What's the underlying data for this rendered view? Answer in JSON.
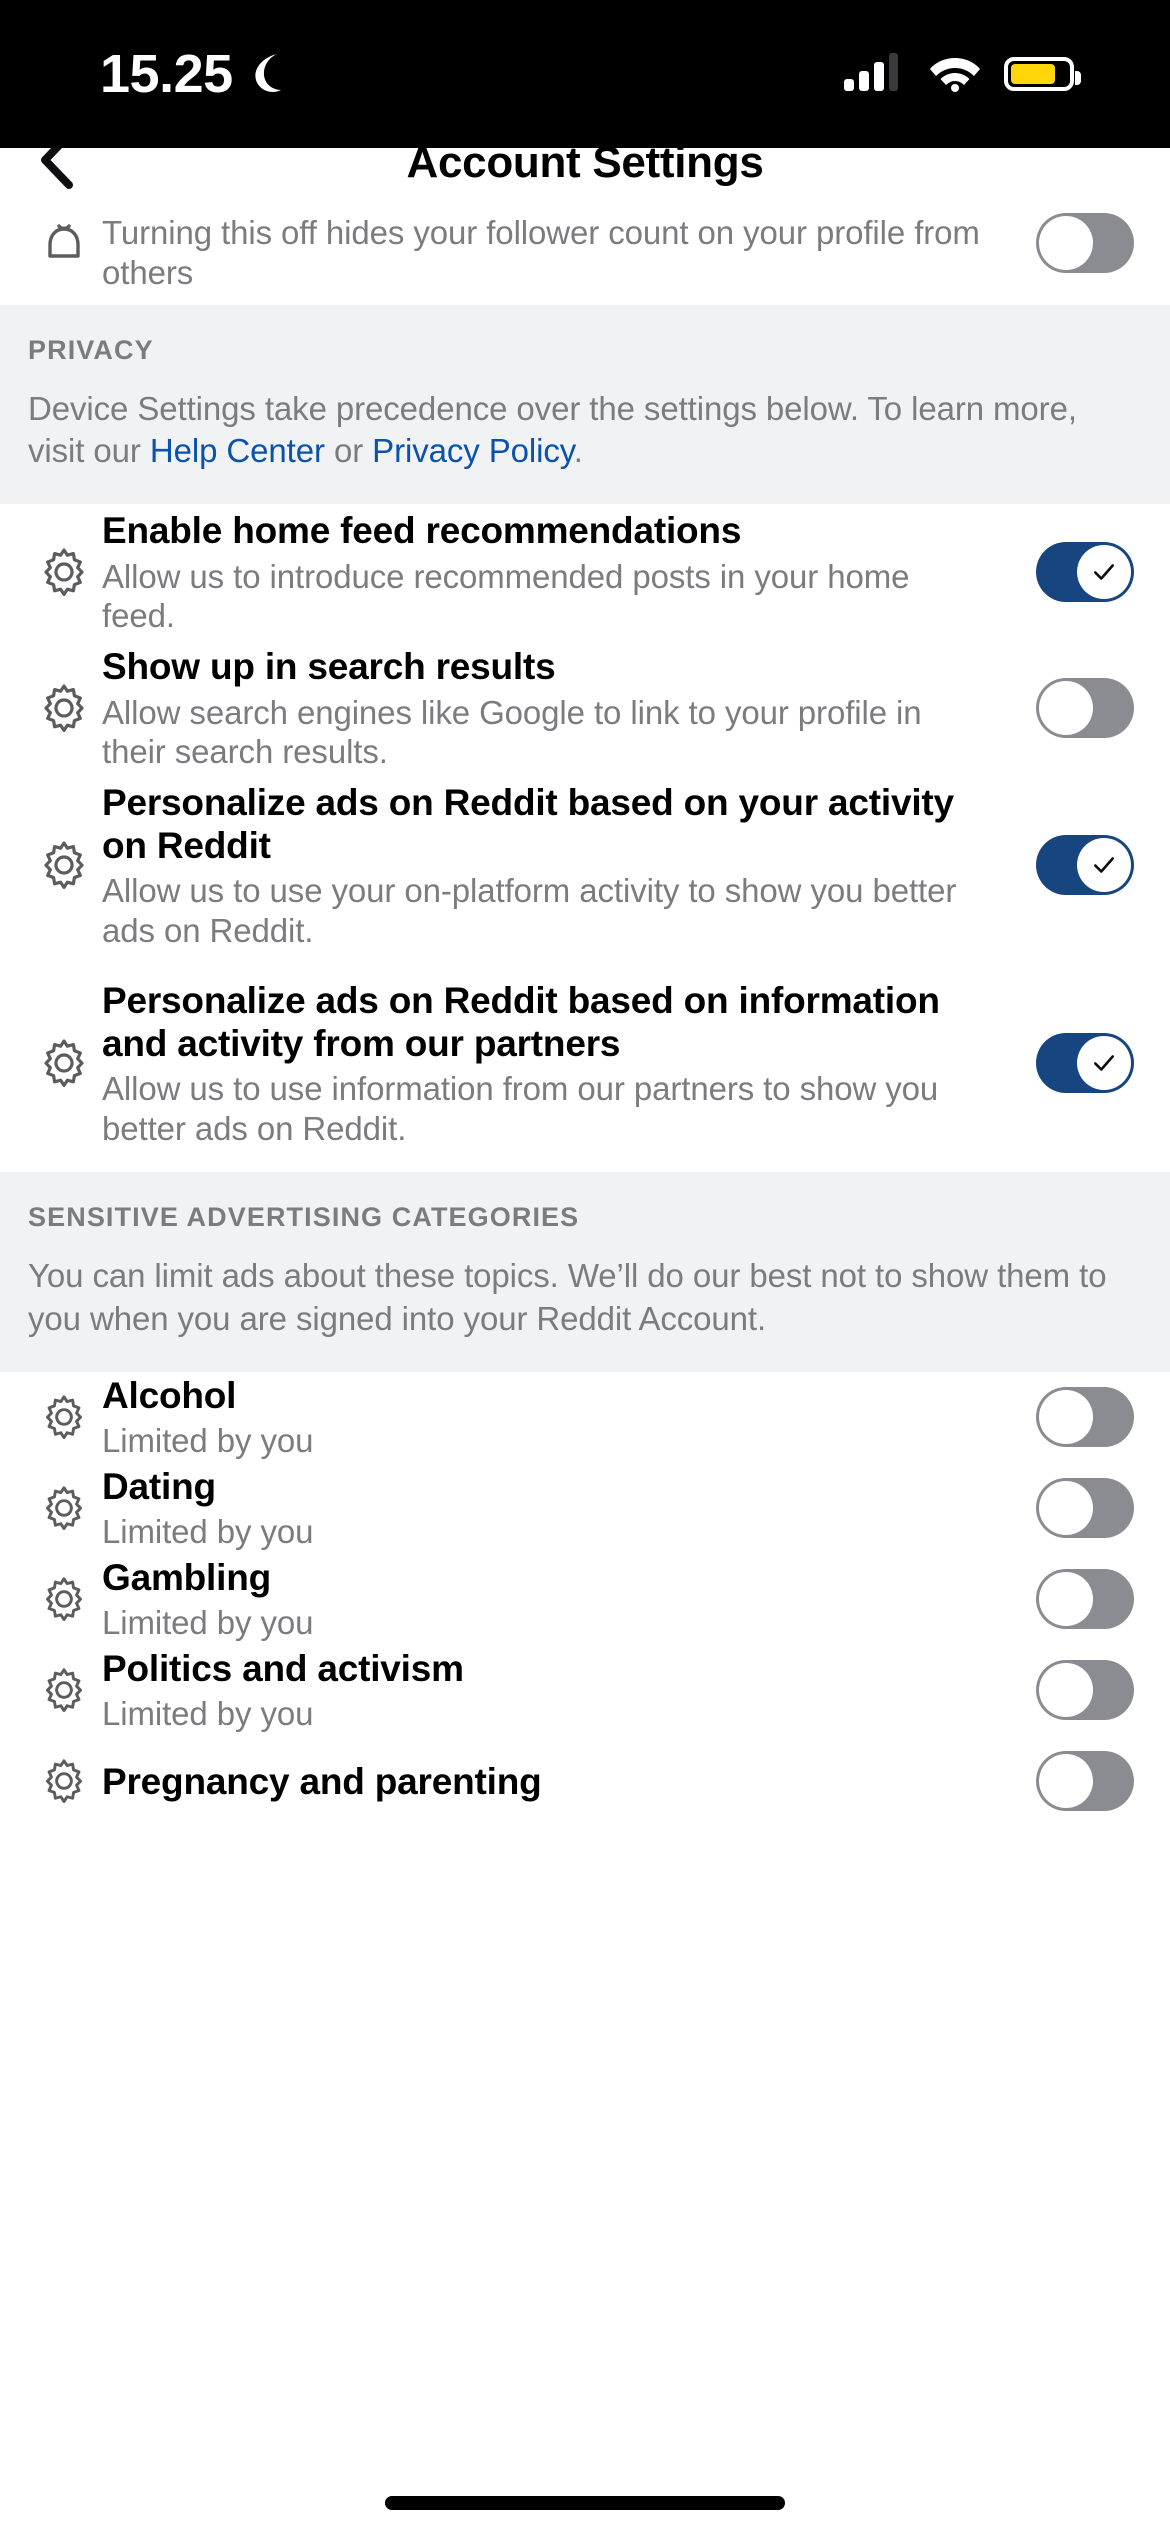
{
  "status_bar": {
    "time": "15.25",
    "moon_icon": "crescent-moon-icon",
    "cellular_icon": "cellular-bars-icon",
    "wifi_icon": "wifi-icon",
    "battery_icon": "battery-icon",
    "battery_color": "#FFD60A"
  },
  "navbar": {
    "back_icon": "chevron-left-icon",
    "title": "Account Settings"
  },
  "clipped_row": {
    "icon": "bell-icon",
    "subtitle": "Turning this off hides your follower count on your profile from others",
    "toggle_state": "off"
  },
  "privacy_section": {
    "label": "PRIVACY",
    "body_before": "Device Settings take precedence over the settings below. To learn more, visit our ",
    "link1": "Help Center",
    "body_middle": " or ",
    "link2": "Privacy Policy",
    "body_after": ".",
    "link_color": "#0b52ad"
  },
  "privacy_rows": [
    {
      "icon": "gear-icon",
      "title": "Enable home feed recommendations",
      "subtitle": "Allow us to introduce recommended posts in your home feed.",
      "toggle_state": "on"
    },
    {
      "icon": "gear-icon",
      "title": "Show up in search results",
      "subtitle": "Allow search engines like Google to link to your profile in their search results.",
      "toggle_state": "off"
    },
    {
      "icon": "gear-icon",
      "title": "Personalize ads on Reddit based on your activity on Reddit",
      "subtitle": "Allow us to use your on-platform activity to show you better ads on Reddit.",
      "toggle_state": "on"
    },
    {
      "icon": "gear-icon",
      "title": "Personalize ads on Reddit based on information and activity from our partners",
      "subtitle": "Allow us to use information from our partners to show you better ads on Reddit.",
      "toggle_state": "on"
    }
  ],
  "sensitive_section": {
    "label": "SENSITIVE ADVERTISING CATEGORIES",
    "body": "You can limit ads about these topics. We’ll do our best not to show them to you when you are signed into your Reddit Account."
  },
  "category_rows": [
    {
      "icon": "gear-icon",
      "title": "Alcohol",
      "subtitle": "Limited by you",
      "toggle_state": "off"
    },
    {
      "icon": "gear-icon",
      "title": "Dating",
      "subtitle": "Limited by you",
      "toggle_state": "off"
    },
    {
      "icon": "gear-icon",
      "title": "Gambling",
      "subtitle": "Limited by you",
      "toggle_state": "off"
    },
    {
      "icon": "gear-icon",
      "title": "Politics and activism",
      "subtitle": "Limited by you",
      "toggle_state": "off"
    },
    {
      "icon": "gear-icon",
      "title": "Pregnancy and parenting",
      "subtitle": "",
      "toggle_state": "off"
    }
  ],
  "colors": {
    "toggle_on": "#17457F",
    "toggle_off": "#8a8c92",
    "section_bg": "#f1f2f4",
    "subtitle": "#7c7c80"
  }
}
